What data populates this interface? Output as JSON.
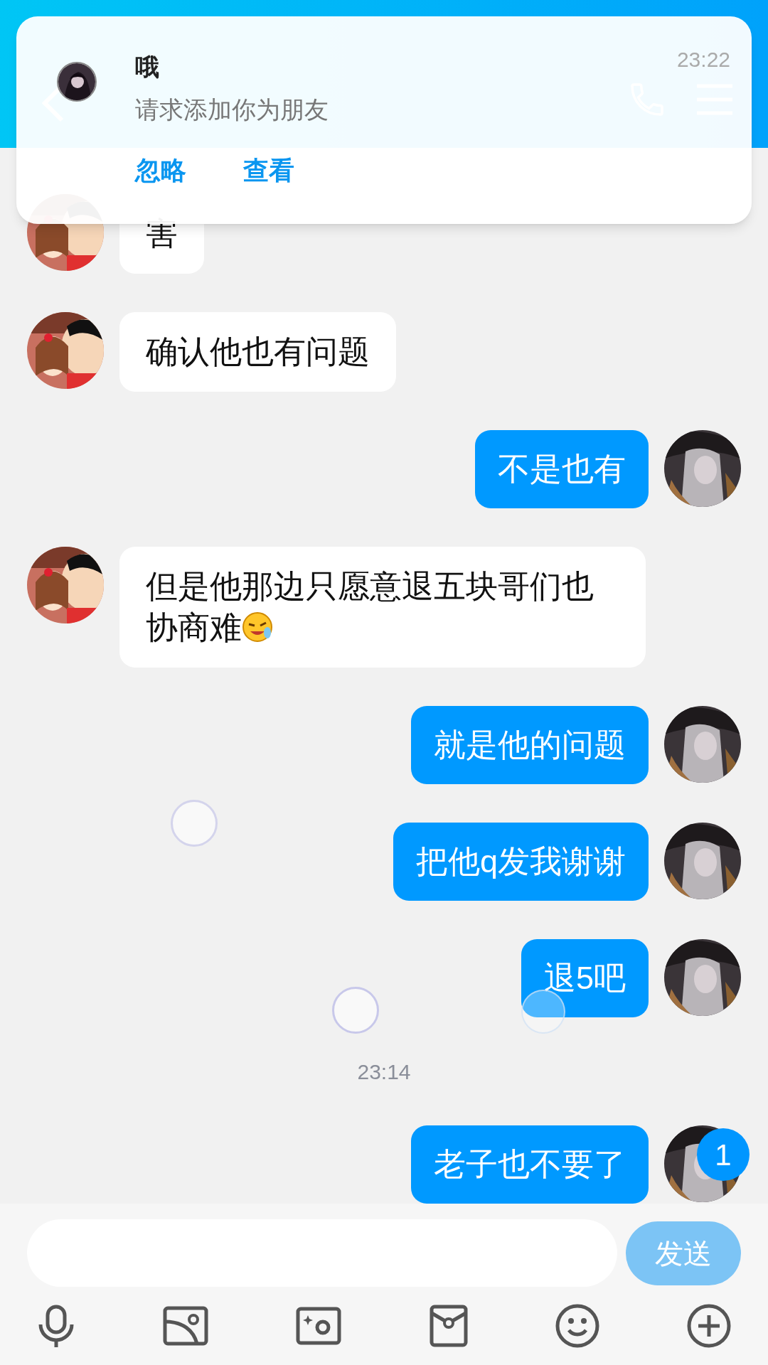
{
  "notification": {
    "title": "哦",
    "message": "请求添加你为朋友",
    "time": "23:22",
    "actions": [
      "忽略",
      "查看"
    ]
  },
  "messages": [
    {
      "kind": "received",
      "text": "害",
      "emoji": false
    },
    {
      "kind": "received",
      "text": "确认他也有问题",
      "emoji": false
    },
    {
      "kind": "sent",
      "text": "不是也有",
      "emoji": false
    },
    {
      "kind": "received",
      "text": "但是他那边只愿意退五块哥们也协商难",
      "emoji": true
    },
    {
      "kind": "sent",
      "text": "就是他的问题",
      "emoji": false
    },
    {
      "kind": "sent",
      "text": "把他q发我谢谢",
      "emoji": false
    },
    {
      "kind": "sent",
      "text": "退5吧",
      "emoji": false
    },
    {
      "kind": "time",
      "text": "23:14"
    },
    {
      "kind": "sent",
      "text": "老子也不要了",
      "emoji": false
    }
  ],
  "unread_badge": "1",
  "send_button": "发送"
}
